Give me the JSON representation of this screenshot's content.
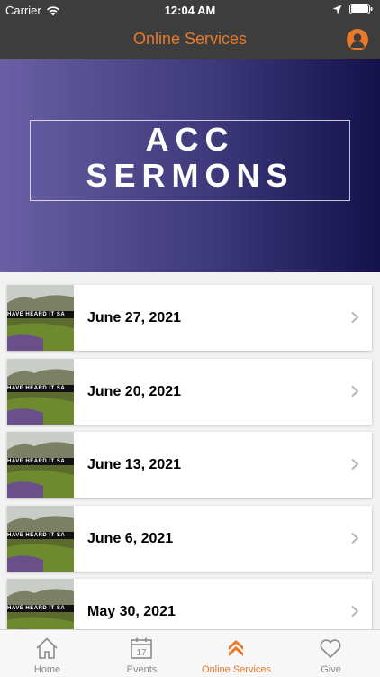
{
  "status_bar": {
    "carrier": "Carrier",
    "time": "12:04 AM"
  },
  "header": {
    "title": "Online Services"
  },
  "banner": {
    "line1": "ACC",
    "line2": "SERMONS"
  },
  "thumbnail_text": "HAVE HEARD IT SA",
  "sermons": [
    {
      "title": "June 27, 2021"
    },
    {
      "title": "June 20, 2021"
    },
    {
      "title": "June 13, 2021"
    },
    {
      "title": "June 6, 2021"
    },
    {
      "title": "May 30, 2021"
    }
  ],
  "tabs": [
    {
      "label": "Home",
      "icon": "home-icon"
    },
    {
      "label": "Events",
      "icon": "calendar-icon",
      "calendar_day": "17"
    },
    {
      "label": "Online Services",
      "icon": "chevrons-up-icon"
    },
    {
      "label": "Give",
      "icon": "heart-icon"
    }
  ],
  "colors": {
    "accent": "#e8792a",
    "bar": "#3d3d3d",
    "banner_start": "#6a5fa4",
    "banner_end": "#14114c"
  }
}
